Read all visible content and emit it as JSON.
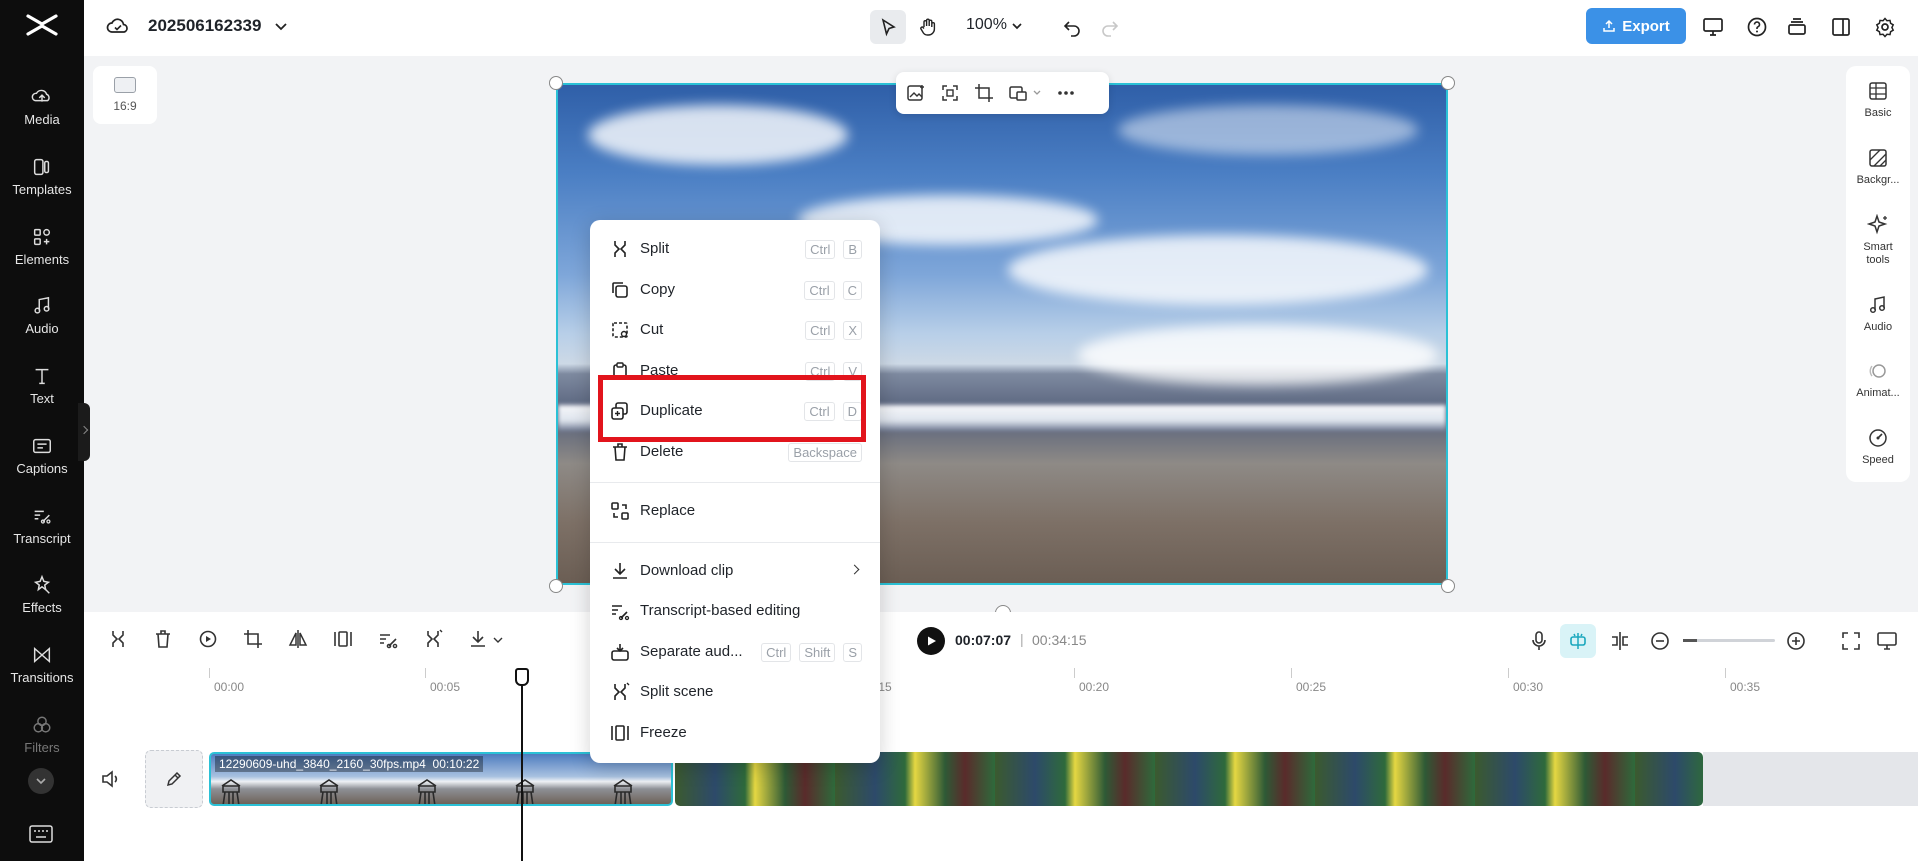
{
  "project": {
    "title": "202506162339"
  },
  "toolbar": {
    "zoom": "100%",
    "export_label": "Export"
  },
  "sidebar": {
    "items": [
      {
        "label": "Media",
        "icon": "media-icon"
      },
      {
        "label": "Templates",
        "icon": "templates-icon"
      },
      {
        "label": "Elements",
        "icon": "elements-icon"
      },
      {
        "label": "Audio",
        "icon": "audio-icon"
      },
      {
        "label": "Text",
        "icon": "text-icon"
      },
      {
        "label": "Captions",
        "icon": "captions-icon"
      },
      {
        "label": "Transcript",
        "icon": "transcript-icon"
      },
      {
        "label": "Effects",
        "icon": "effects-icon"
      },
      {
        "label": "Transitions",
        "icon": "transitions-icon"
      },
      {
        "label": "Filters",
        "icon": "filters-icon"
      }
    ]
  },
  "canvas": {
    "ratio_label": "16:9"
  },
  "right_panel": {
    "items": [
      {
        "label": "Basic"
      },
      {
        "label": "Backgr..."
      },
      {
        "label": "Smart tools"
      },
      {
        "label": "Audio"
      },
      {
        "label": "Animat..."
      },
      {
        "label": "Speed"
      }
    ]
  },
  "context_menu": {
    "items": [
      {
        "label": "Split",
        "keys": [
          "Ctrl",
          "B"
        ]
      },
      {
        "label": "Copy",
        "keys": [
          "Ctrl",
          "C"
        ]
      },
      {
        "label": "Cut",
        "keys": [
          "Ctrl",
          "X"
        ]
      },
      {
        "label": "Paste",
        "keys": [
          "Ctrl",
          "V"
        ]
      },
      {
        "label": "Duplicate",
        "keys": [
          "Ctrl",
          "D"
        ]
      },
      {
        "label": "Delete",
        "keys": [
          "Backspace"
        ]
      },
      {
        "label": "Replace",
        "keys": []
      },
      {
        "label": "Download clip",
        "keys": []
      },
      {
        "label": "Transcript-based editing",
        "keys": []
      },
      {
        "label": "Separate aud...",
        "keys": [
          "Ctrl",
          "Shift",
          "S"
        ]
      },
      {
        "label": "Split scene",
        "keys": []
      },
      {
        "label": "Freeze",
        "keys": []
      }
    ]
  },
  "timeline": {
    "current_time": "00:07:07",
    "separator": "|",
    "total_time": "00:34:15",
    "ticks": [
      "00:00",
      "00:05",
      ":15",
      "00:20",
      "00:25",
      "00:30",
      "00:35"
    ],
    "clip_name": "12290609-uhd_3840_2160_30fps.mp4",
    "clip_duration": "00:10:22"
  },
  "colors": {
    "accent": "#3b91e7",
    "selection": "#2bc1d6",
    "highlight": "#e2141c"
  }
}
